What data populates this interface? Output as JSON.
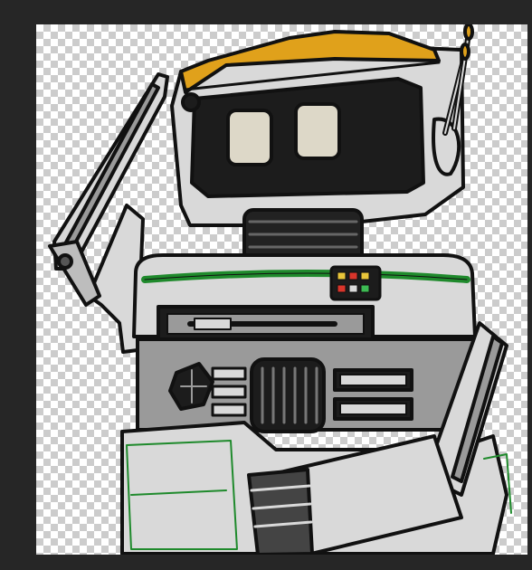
{
  "document": {
    "background": "transparent-checkerboard",
    "subject": "robot-drawing"
  },
  "colors": {
    "workspace_bg": "#262626",
    "checker_light": "#ffffff",
    "checker_dark": "#cccccc",
    "robot_body": "#d9d9d9",
    "robot_shadow": "#9a9a9a",
    "outline": "#111111",
    "hat_orange": "#e0a11b",
    "stripe_green": "#1f8a2c",
    "visor_dark": "#1c1c1c",
    "eye_cream": "#ddd8c8",
    "led_red": "#d9352b",
    "led_yellow": "#e9c53a",
    "led_green": "#3dbb53"
  }
}
